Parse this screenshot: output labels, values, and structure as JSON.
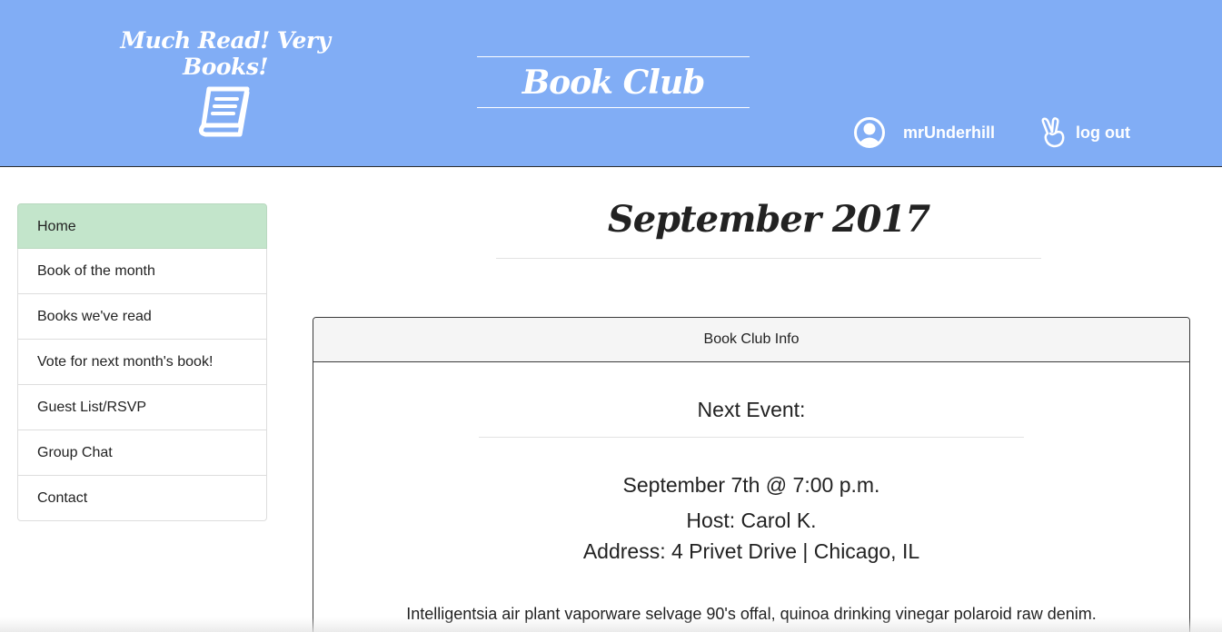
{
  "header": {
    "tagline": "Much Read! Very Books!",
    "site_title": "Book Club",
    "username": "mrUnderhill",
    "logout_label": "log out",
    "background_color": "#81adf5"
  },
  "icons": {
    "logo": "book-icon",
    "user": "user-circle-icon",
    "logout": "peace-hand-icon"
  },
  "sidebar": {
    "items": [
      {
        "label": "Home",
        "active": true
      },
      {
        "label": "Book of the month"
      },
      {
        "label": "Books we've read"
      },
      {
        "label": "Vote for next month's book!"
      },
      {
        "label": "Guest List/RSVP"
      },
      {
        "label": "Group Chat"
      },
      {
        "label": "Contact"
      }
    ],
    "active_color": "#c3e5cb"
  },
  "main": {
    "month_title": "September 2017",
    "panel": {
      "heading": "Book Club Info",
      "next_event_label": "Next Event:",
      "date_time": "September 7th @ 7:00 p.m.",
      "host": "Host: Carol K.",
      "address": "Address: 4 Privet Drive | Chicago, IL",
      "description": "Intelligentsia air plant vaporware selvage 90's offal, quinoa drinking vinegar polaroid raw denim."
    }
  }
}
